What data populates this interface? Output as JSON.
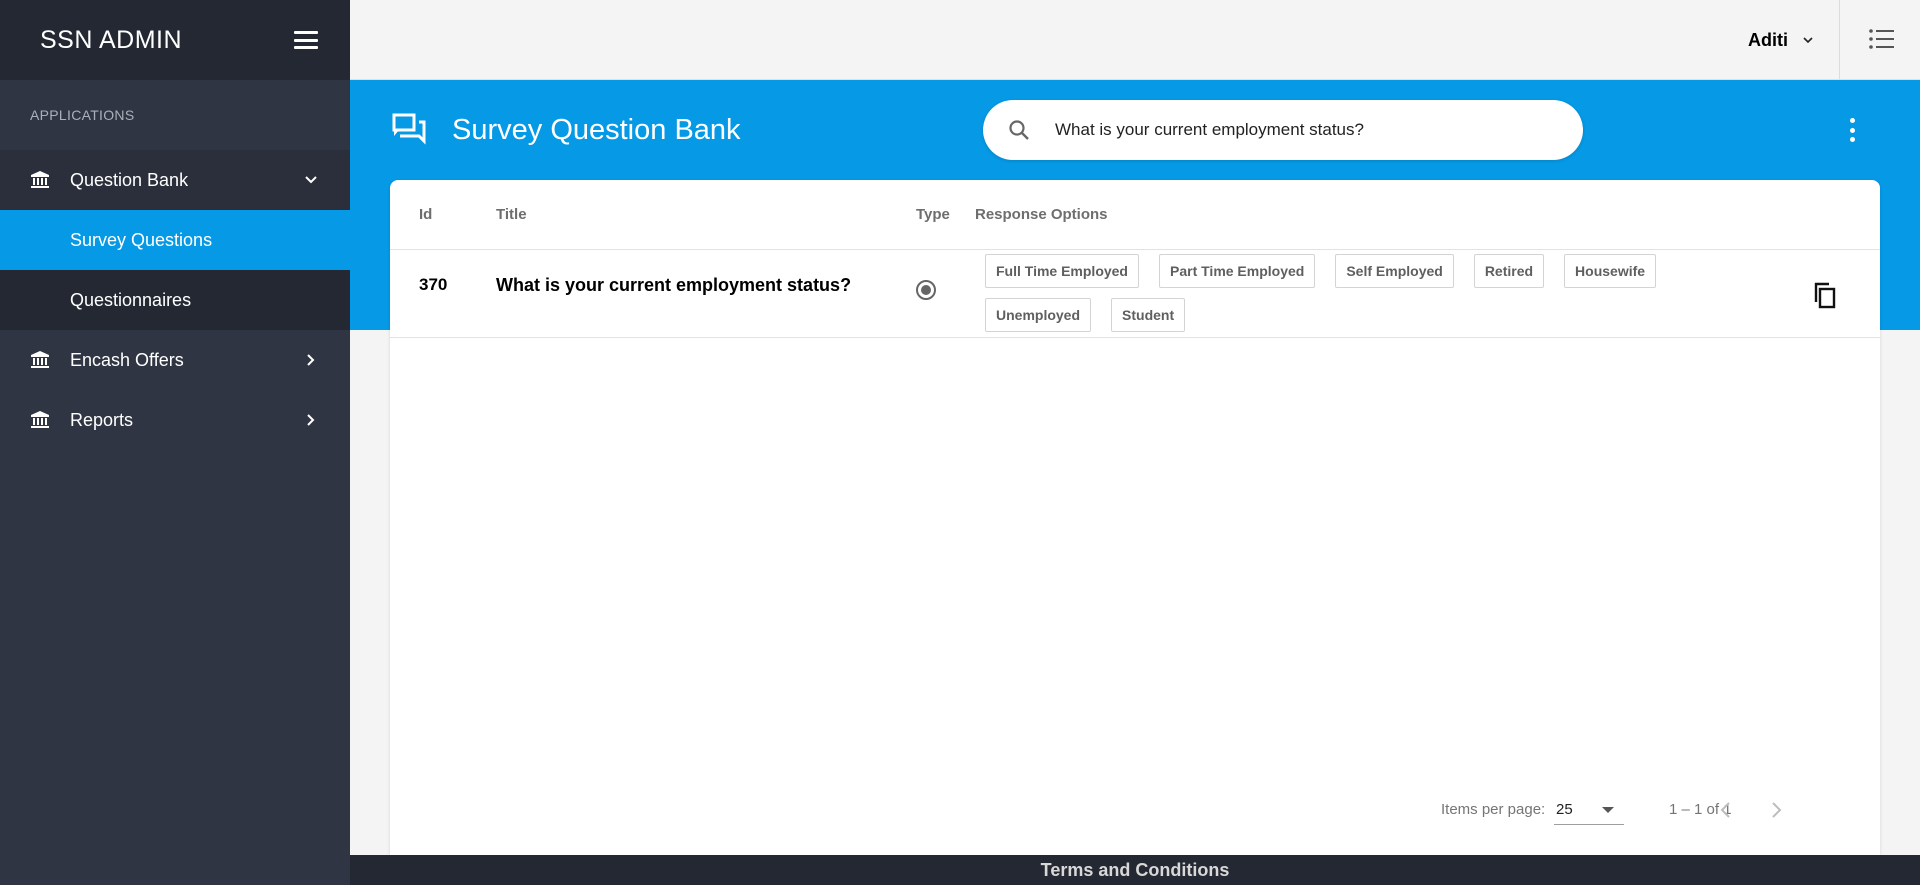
{
  "sidebar": {
    "brand": "SSN ADMIN",
    "section_label": "APPLICATIONS",
    "items": {
      "question_bank": "Question Bank",
      "survey_questions": "Survey Questions",
      "questionnaires": "Questionnaires",
      "encash_offers": "Encash Offers",
      "reports": "Reports"
    }
  },
  "topbar": {
    "user_name": "Aditi"
  },
  "header": {
    "title": "Survey Question Bank",
    "search_value": "What is your current employment status?"
  },
  "table": {
    "columns": [
      "Id",
      "Title",
      "Type",
      "Response Options"
    ],
    "rows": [
      {
        "id": "370",
        "title": "What is your current employment status?",
        "type_icon": "radio-button-icon",
        "options": [
          "Full Time Employed",
          "Part Time Employed",
          "Self Employed",
          "Retired",
          "Housewife",
          "Unemployed",
          "Student"
        ]
      }
    ]
  },
  "paginator": {
    "items_per_page_label": "Items per page:",
    "items_per_page": "25",
    "range": "1 – 1 of 1"
  },
  "footer": {
    "link": "Terms and Conditions"
  },
  "colors": {
    "accent": "#0699e5",
    "sidebar": "#2f3542",
    "sidebar_dark": "#232833"
  }
}
